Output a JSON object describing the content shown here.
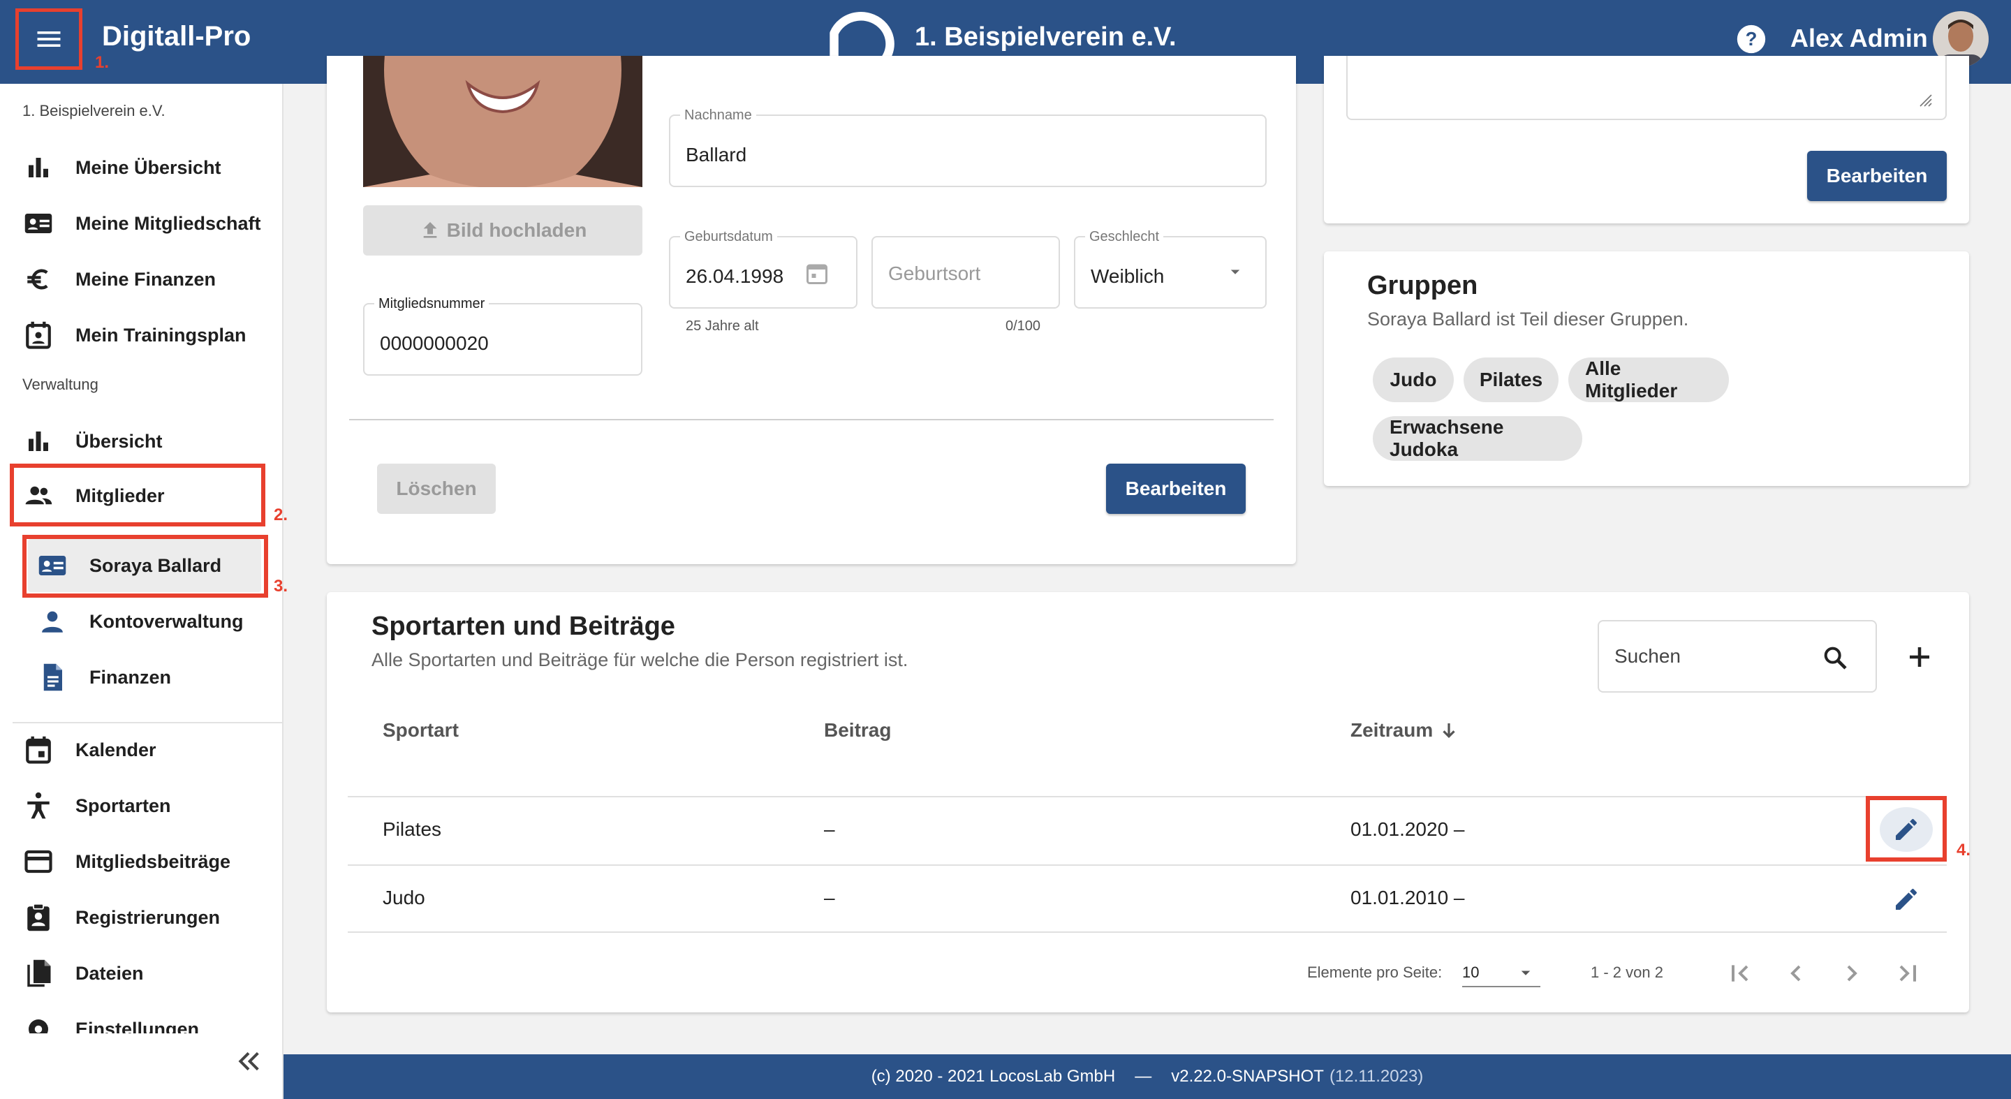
{
  "header": {
    "app_title": "Digitall-Pro",
    "org_title": "1. Beispielverein e.V.",
    "user_name": "Alex Admin",
    "anno1": "1."
  },
  "sidebar": {
    "org_label": "1. Beispielverein e.V.",
    "items_personal": [
      {
        "label": "Meine Übersicht",
        "icon": "bar-chart-icon"
      },
      {
        "label": "Meine Mitgliedschaft",
        "icon": "id-card-icon"
      },
      {
        "label": "Meine Finanzen",
        "icon": "euro-icon"
      },
      {
        "label": "Mein Trainingsplan",
        "icon": "calendar-person-icon"
      }
    ],
    "section_admin": "Verwaltung",
    "items_admin": [
      {
        "label": "Übersicht",
        "icon": "bar-chart-icon"
      },
      {
        "label": "Mitglieder",
        "icon": "people-icon"
      }
    ],
    "sub_items": [
      {
        "label": "Soraya Ballard",
        "icon": "id-card-icon"
      },
      {
        "label": "Kontoverwaltung",
        "icon": "person-icon"
      },
      {
        "label": "Finanzen",
        "icon": "document-icon"
      }
    ],
    "items_other": [
      {
        "label": "Kalender",
        "icon": "calendar-icon"
      },
      {
        "label": "Sportarten",
        "icon": "sport-icon"
      },
      {
        "label": "Mitgliedsbeiträge",
        "icon": "card-icon"
      },
      {
        "label": "Registrierungen",
        "icon": "clipboard-person-icon"
      },
      {
        "label": "Dateien",
        "icon": "files-icon"
      },
      {
        "label": "Einstellungen",
        "icon": "gear-icon"
      }
    ],
    "anno2": "2.",
    "anno3": "3."
  },
  "profile": {
    "upload_label": "Bild hochladen",
    "member_number_label": "Mitgliedsnummer",
    "member_number": "0000000020",
    "lastname_label": "Nachname",
    "lastname": "Ballard",
    "birthdate_label": "Geburtsdatum",
    "birthdate": "26.04.1998",
    "age_hint": "25 Jahre alt",
    "birthplace_placeholder": "Geburtsort",
    "birthplace_counter": "0/100",
    "gender_label": "Geschlecht",
    "gender": "Weiblich",
    "delete_label": "Löschen",
    "edit_label": "Bearbeiten"
  },
  "notes_card": {
    "edit_label": "Bearbeiten"
  },
  "groups": {
    "title": "Gruppen",
    "subtitle": "Soraya Ballard ist Teil dieser Gruppen.",
    "chips": [
      "Judo",
      "Pilates",
      "Alle Mitglieder",
      "Erwachsene Judoka"
    ]
  },
  "sports": {
    "title": "Sportarten und Beiträge",
    "subtitle": "Alle Sportarten und Beiträge für welche die Person registriert ist.",
    "search_placeholder": "Suchen",
    "columns": [
      "Sportart",
      "Beitrag",
      "Zeitraum"
    ],
    "rows": [
      {
        "sport": "Pilates",
        "fee": "–",
        "period": "01.01.2020 –"
      },
      {
        "sport": "Judo",
        "fee": "–",
        "period": "01.01.2010 –"
      }
    ],
    "per_page_label": "Elemente pro Seite:",
    "per_page_value": "10",
    "range_label": "1 - 2 von 2",
    "anno4": "4."
  },
  "footer": {
    "copyright": "(c) 2020 - 2021 LocosLab GmbH",
    "separator": "—",
    "version": "v2.22.0-SNAPSHOT",
    "date": "(12.11.2023)"
  },
  "colors": {
    "primary": "#2b5288",
    "annotation": "#e8402e"
  }
}
